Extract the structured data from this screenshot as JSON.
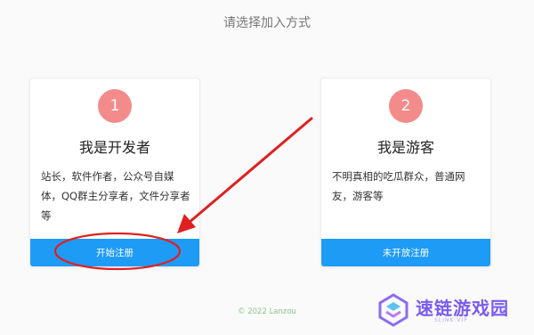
{
  "header": {
    "title": "请选择加入方式"
  },
  "cards": [
    {
      "badge": "1",
      "title": "我是开发者",
      "description": "站长，软件作者，公众号自媒体，QQ群主分享者，文件分享者等",
      "button_label": "开始注册"
    },
    {
      "badge": "2",
      "title": "我是游客",
      "description": "不明真相的吃瓜群众，普通网友，游客等",
      "button_label": "未开放注册"
    }
  ],
  "footer": {
    "copyright": "© 2022 Lanzou"
  },
  "watermark": {
    "brand": "速链游戏园",
    "sub": "SLINK.VIP"
  },
  "colors": {
    "badge": "#f48b8b",
    "button": "#1e9bf5",
    "annotation": "#e02020",
    "footer_text": "#8ac58a"
  }
}
